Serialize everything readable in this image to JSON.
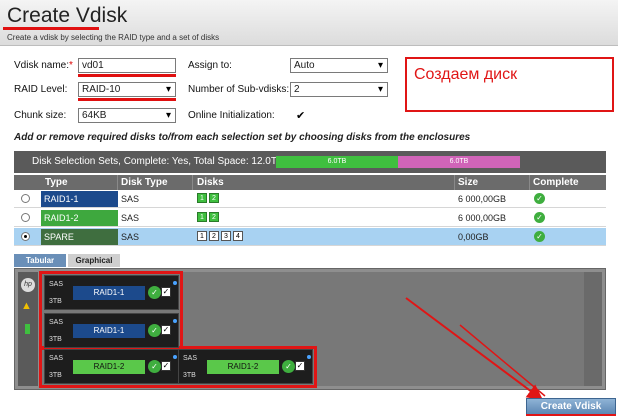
{
  "header": {
    "title": "Create Vdisk",
    "subtitle": "Create a vdisk by selecting the RAID type and a set of disks"
  },
  "form": {
    "vdisk_name_label": "Vdisk name:",
    "vdisk_name_required": "*",
    "vdisk_name_value": "vd01",
    "raid_level_label": "RAID Level:",
    "raid_level_value": "RAID-10",
    "chunk_size_label": "Chunk size:",
    "chunk_size_value": "64KB",
    "assign_to_label": "Assign to:",
    "assign_to_value": "Auto",
    "subvdisks_label": "Number of Sub-vdisks:",
    "subvdisks_value": "2",
    "online_init_label": "Online Initialization:",
    "online_init_checked": "✔"
  },
  "callout": {
    "text": "Создаем диск"
  },
  "instructions": "Add or remove required disks to/from each selection set by choosing disks from the enclosures",
  "selection_sets": {
    "summary": "Disk Selection Sets, Complete: Yes, Total Space: 12.0TB:",
    "segments": [
      {
        "label": "6.0TB",
        "color": "#3fbf3f"
      },
      {
        "label": "6.0TB",
        "color": "#d064b8"
      }
    ]
  },
  "table": {
    "headers": [
      "Type",
      "Disk Type",
      "Disks",
      "Size",
      "Complete"
    ],
    "rows": [
      {
        "type": "RAID1-1",
        "type_color": "#1c4a8c",
        "disk_type": "SAS",
        "disks": [
          "1",
          "2"
        ],
        "disk_color": "#3fbf3f",
        "size": "6 000,00GB",
        "selected": false
      },
      {
        "type": "RAID1-2",
        "type_color": "#3ea83e",
        "disk_type": "SAS",
        "disks": [
          "1",
          "2"
        ],
        "disk_color": "#3fbf3f",
        "size": "6 000,00GB",
        "selected": false
      },
      {
        "type": "SPARE",
        "type_color": "#3f6e3f",
        "disk_type": "SAS",
        "disks": [
          "1",
          "2",
          "3",
          "4"
        ],
        "disk_color": "#ffffff",
        "size": "0,00GB",
        "selected": true
      }
    ]
  },
  "view_tabs": [
    "Tabular",
    "Graphical"
  ],
  "enclosure": {
    "brand": "hp",
    "drives": [
      {
        "sas": "SAS",
        "tb": "3TB",
        "tag": "RAID1-1",
        "tag_color": "#1c4a8c"
      },
      {
        "sas": "SAS",
        "tb": "3TB",
        "tag": "RAID1-1",
        "tag_color": "#1c4a8c"
      },
      {
        "sas": "SAS",
        "tb": "3TB",
        "tag": "RAID1-2",
        "tag_color": "#5ac84a"
      },
      {
        "sas": "SAS",
        "tb": "3TB",
        "tag": "RAID1-2",
        "tag_color": "#5ac84a"
      }
    ]
  },
  "actions": {
    "create_label": "Create Vdisk"
  }
}
